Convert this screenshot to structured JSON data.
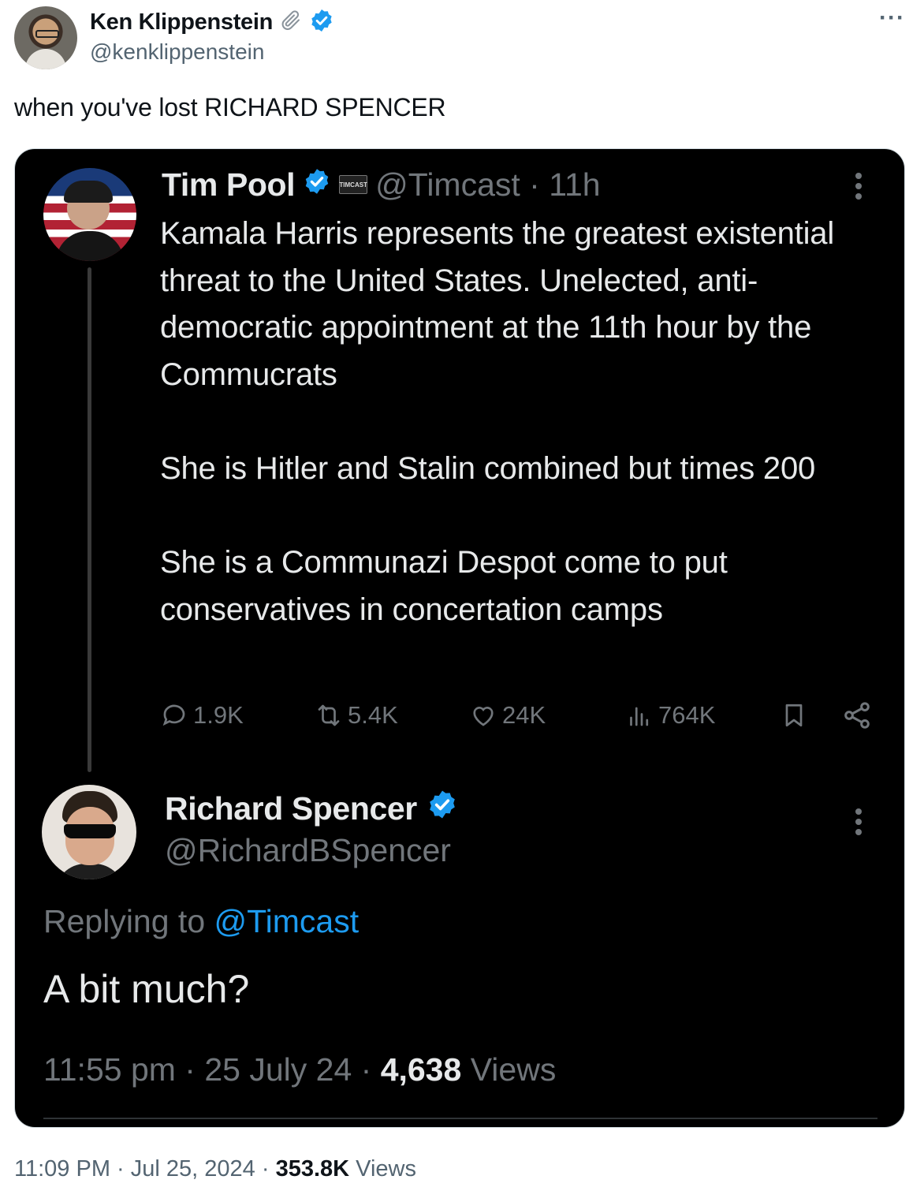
{
  "tweet": {
    "author_name": "Ken Klippenstein",
    "author_handle": "@kenklippenstein",
    "text": "when you've lost RICHARD SPENCER",
    "footer": {
      "time": "11:09 PM",
      "sep1": "·",
      "date": "Jul 25, 2024",
      "sep2": "·",
      "views_count": "353.8K",
      "views_label": "Views"
    },
    "more_label": "···"
  },
  "embedded": {
    "original": {
      "author_name": "Tim Pool",
      "badge_text": "TIMCAST",
      "handle_time": "@Timcast · 11h",
      "paragraphs": [
        "Kamala Harris represents the greatest existential threat to the United States. Unelected, anti-democratic appointment at the 11th hour by the Commucrats",
        "She is Hitler and Stalin combined but times 200",
        "She is a Communazi Despot come to put conservatives in concertation camps"
      ],
      "stats": {
        "replies": "1.9K",
        "reposts": "5.4K",
        "likes": "24K",
        "views": "764K"
      }
    },
    "reply": {
      "author_name": "Richard Spencer",
      "author_handle": "@RichardBSpencer",
      "replying_prefix": "Replying to ",
      "replying_mention": "@Timcast",
      "text": "A bit much?",
      "time": "11:55 pm",
      "sep1": " · ",
      "date": "25 July 24",
      "sep2": " · ",
      "views_count": "4,638",
      "views_label": " Views"
    }
  },
  "colors": {
    "verified_blue": "#1d9bf0",
    "dark_bg": "#000000",
    "muted": "#71767b"
  }
}
